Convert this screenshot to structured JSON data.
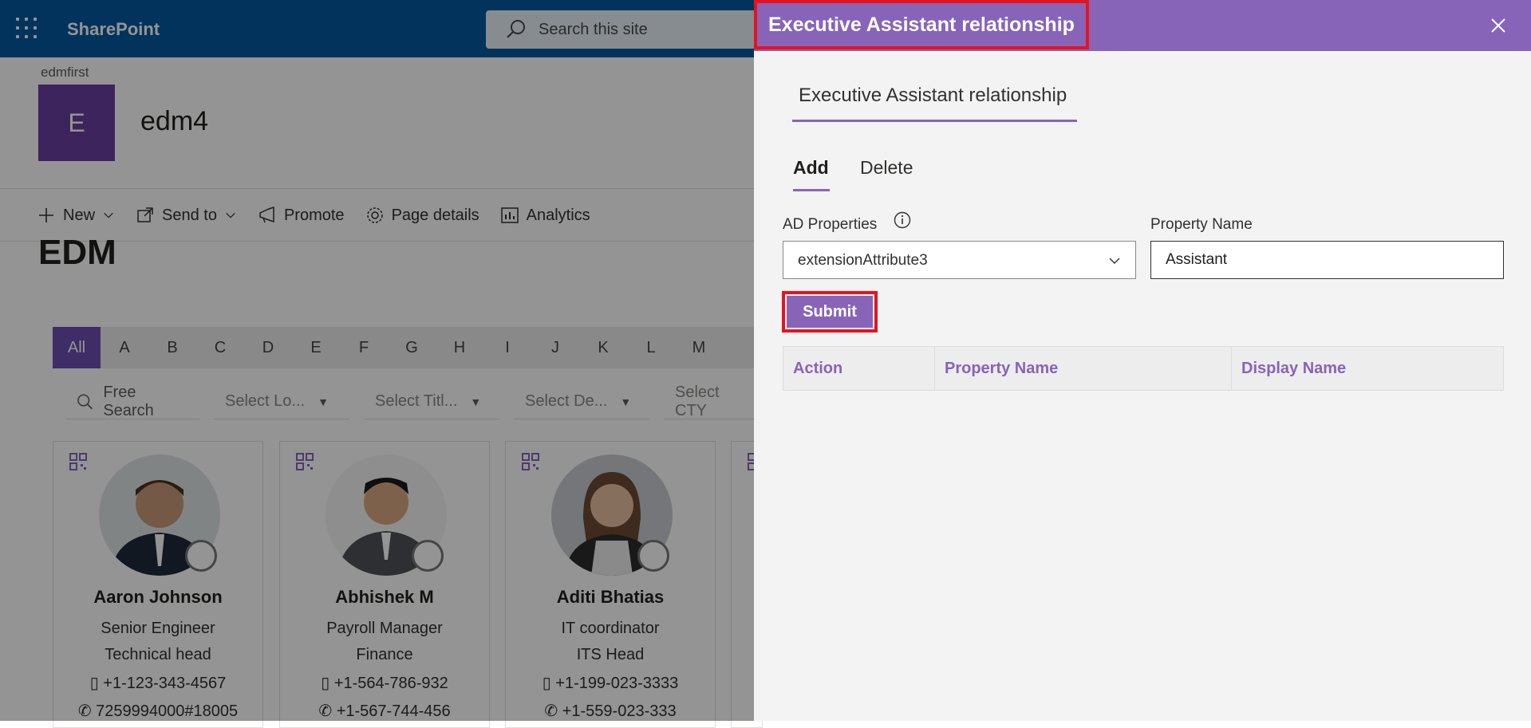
{
  "topbar": {
    "brand": "SharePoint",
    "search_placeholder": "Search this site"
  },
  "site": {
    "breadcrumb": "edmfirst",
    "logo_letter": "E",
    "title": "edm4"
  },
  "command_bar": [
    "New",
    "Send to",
    "Promote",
    "Page details",
    "Analytics"
  ],
  "page": {
    "heading": "EDM"
  },
  "alphabet": [
    "All",
    "A",
    "B",
    "C",
    "D",
    "E",
    "F",
    "G",
    "H",
    "I",
    "J",
    "K",
    "L",
    "M"
  ],
  "filters": {
    "search": "Free Search",
    "location": "Select Lo...",
    "title": "Select Titl...",
    "department": "Select De...",
    "city": "Select CTY"
  },
  "cards": [
    {
      "name": "Aaron Johnson",
      "line1": "Senior Engineer",
      "line2": "Technical head",
      "phone1": "+1-123-343-4567",
      "phone2": "7259994000#18005"
    },
    {
      "name": "Abhishek M",
      "line1": "Payroll Manager",
      "line2": "Finance",
      "phone1": "+1-564-786-932",
      "phone2": "+1-567-744-456"
    },
    {
      "name": "Aditi Bhatias",
      "line1": "IT coordinator",
      "line2": "ITS Head",
      "phone1": "+1-199-023-3333",
      "phone2": "+1-559-023-333"
    }
  ],
  "panel": {
    "title": "Executive Assistant relationship",
    "section_tab": "Executive Assistant relationship",
    "tabs": {
      "add": "Add",
      "delete": "Delete"
    },
    "ad_label": "AD Properties",
    "ad_value": "extensionAttribute3",
    "property_label": "Property Name",
    "property_value": "Assistant",
    "submit": "Submit",
    "table_headers": [
      "Action",
      "Property Name",
      "Display Name"
    ]
  },
  "colors": {
    "brand_bar": "#03589f",
    "accent": "#8764b8",
    "highlight": "#e8121e"
  }
}
